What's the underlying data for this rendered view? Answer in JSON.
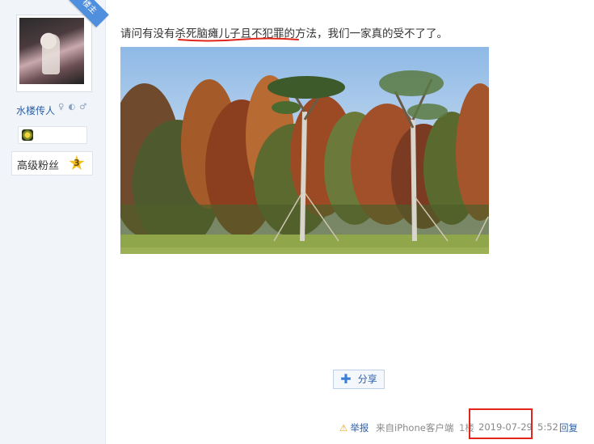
{
  "user": {
    "badge_label": "楼主",
    "username": "水楼传人",
    "user_icons": "♀ ◐ ♂",
    "rank_label": "高级粉丝",
    "rank_level": "3"
  },
  "post": {
    "text_before": "请问有没有",
    "text_highlight": "杀死脑瘫儿子且不犯罪",
    "text_after": "的方法，我们一家真的受不了了。"
  },
  "actions": {
    "share_label": "分享",
    "report_label": "举报",
    "source_label": "来自iPhone客户端",
    "floor_label": "1楼",
    "date": "2019-07-29",
    "time": "5:52",
    "reply_label": "回复"
  },
  "colors": {
    "link_blue": "#2b5fa8",
    "highlight_red": "#e0251b",
    "sidebar_bg": "#f1f4f8"
  }
}
